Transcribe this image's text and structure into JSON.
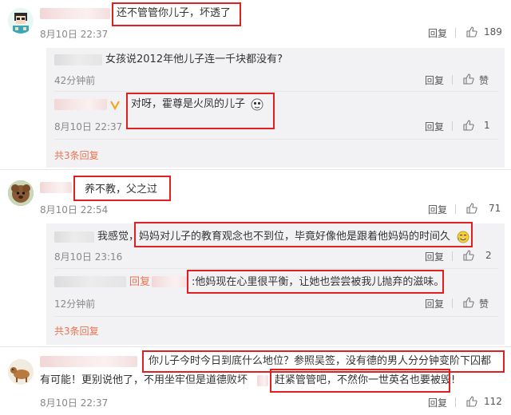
{
  "c1": {
    "text": "还不管管你儿子，坏透了",
    "time": "8月10日 22:37",
    "reply": "回复",
    "likes": "189",
    "sub": [
      {
        "text": "女孩说2012年他儿子连一千块都没有?",
        "time": "42分钟前",
        "reply": "回复",
        "likes": "赞"
      },
      {
        "text": "对呀，霍尊是火凤的儿子",
        "time": "8月10日 22:37",
        "reply": "回复",
        "likes": "1"
      }
    ],
    "more": "共3条回复"
  },
  "c2": {
    "text": "养不教，父之过",
    "time": "8月10日 22:54",
    "reply": "回复",
    "likes": "71",
    "sub": [
      {
        "prefix": "我感觉，",
        "text": "妈妈对儿子的教育观念也不到位，毕竟好像他是跟着他妈妈的时间久",
        "time": "8月10日 23:16",
        "reply": "回复",
        "likes": "2"
      },
      {
        "prefix": "回复",
        "text": ":他妈现在心里很平衡，让她也尝尝被我儿抛弃的滋味。",
        "time": "12分钟前",
        "reply": "回复",
        "likes": "赞"
      }
    ],
    "more": "共3条回复"
  },
  "c3": {
    "text1": "你儿子今时今日到底什么地位？参照吴签，没有德的男人分分钟变阶下囚都",
    "text2a": "有可能！更别说他了，不用坐牢但是道德败坏",
    "text2b": "赶紧管管吧，不然你一世英名也要被毁!",
    "time": "8月10日 22:37",
    "reply": "回复",
    "likes": "112"
  },
  "colors": {
    "link": "#eb7350",
    "highlight": "#e02020",
    "sub_bg": "#f2f2f5"
  }
}
